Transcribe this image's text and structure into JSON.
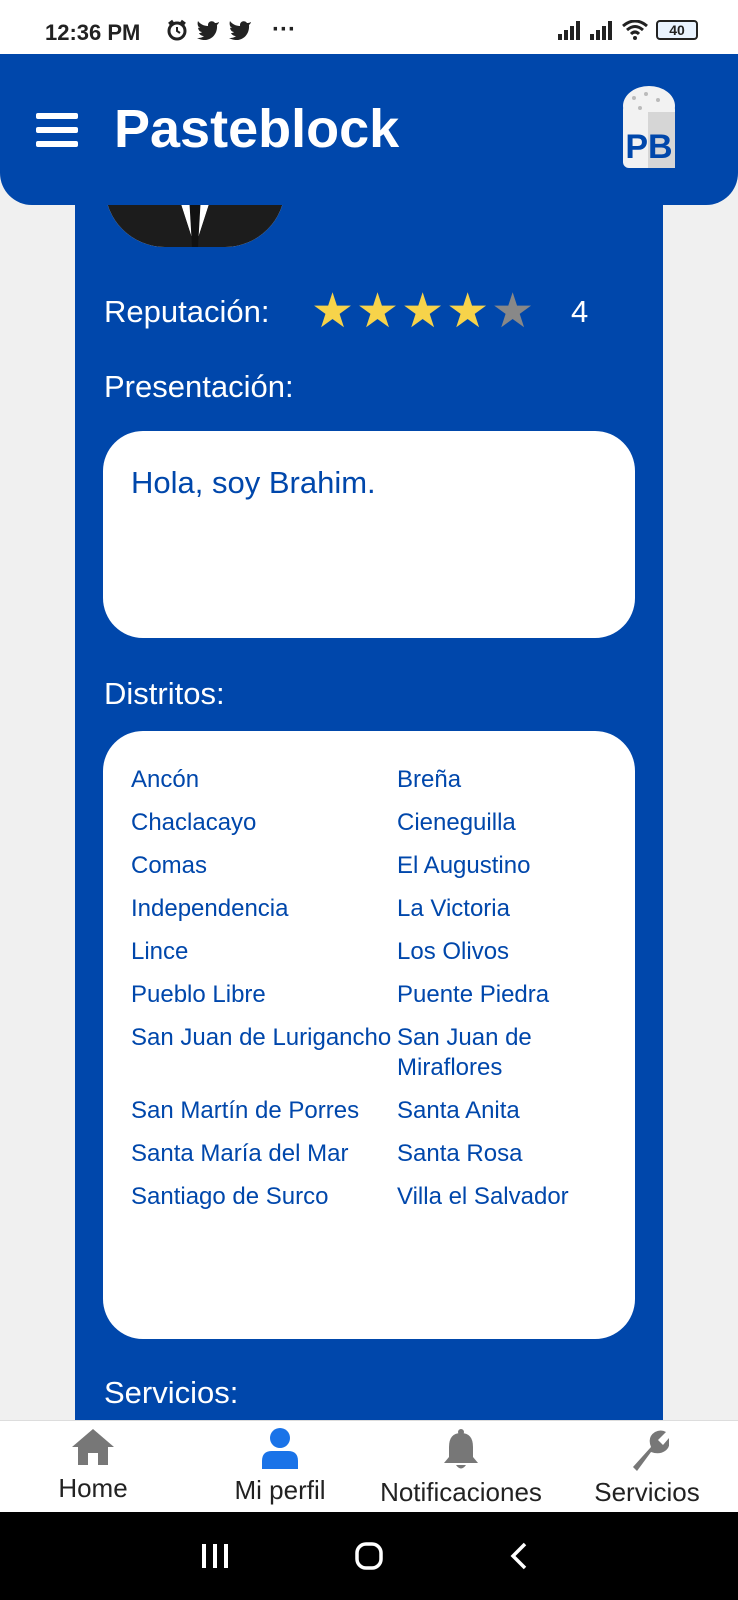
{
  "status_bar": {
    "time": "12:36 PM",
    "more": "···",
    "battery": "40",
    "left_icons": [
      "alarm-icon",
      "twitter-icon",
      "twitter-icon"
    ],
    "right_icons": [
      "signal-icon",
      "signal-icon",
      "wifi-icon",
      "battery-icon"
    ]
  },
  "header": {
    "title": "Pasteblock",
    "menu_icon": "hamburger-menu-icon",
    "logo_text": "PB"
  },
  "profile": {
    "reputation_label": "Reputación:",
    "reputation_value": "4",
    "rating": 4,
    "rating_max": 5,
    "presentation_label": "Presentación:",
    "presentation_text": "Hola, soy Brahim.",
    "districts_label": "Distritos:",
    "districts": [
      "Ancón",
      "Breña",
      "Chaclacayo",
      "Cieneguilla",
      "Comas",
      "El Augustino",
      "Independencia",
      "La Victoria",
      "Lince",
      "Los Olivos",
      "Pueblo Libre",
      "Puente Piedra",
      "San Juan de Lurigancho",
      "San Juan de Miraflores",
      "San Martín de Porres",
      "Santa Anita",
      "Santa María del Mar",
      "Santa Rosa",
      "Santiago de Surco",
      "Villa el Salvador"
    ],
    "services_label": "Servicios:"
  },
  "bottom_nav": [
    {
      "label": "Home",
      "icon": "home-icon",
      "active": false
    },
    {
      "label": "Mi perfil",
      "icon": "user-icon",
      "active": true
    },
    {
      "label": "Notificaciones",
      "icon": "bell-icon",
      "active": false
    },
    {
      "label": "Servicios",
      "icon": "wrench-icon",
      "active": false
    }
  ],
  "colors": {
    "primary": "#0047ab",
    "star_filled": "#f7d34a",
    "star_empty": "#888888",
    "nav_active": "#1a73e8",
    "nav_inactive": "#777777"
  }
}
